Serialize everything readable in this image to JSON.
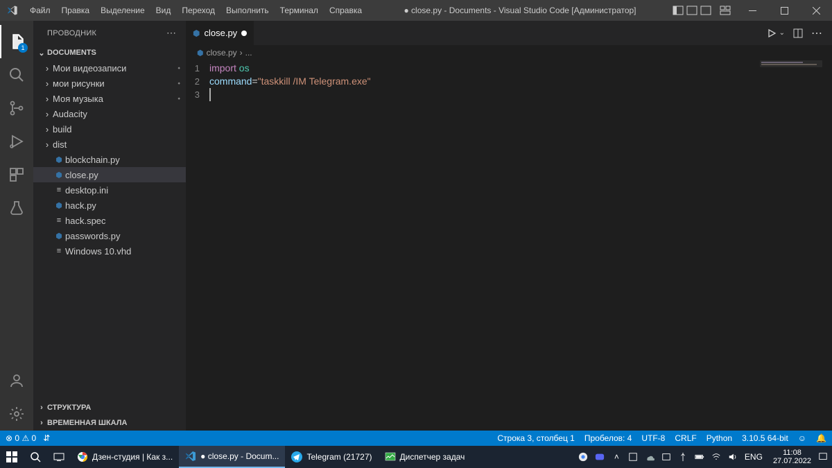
{
  "titlebar": {
    "menus": [
      "Файл",
      "Правка",
      "Выделение",
      "Вид",
      "Переход",
      "Выполнить",
      "Терминал",
      "Справка"
    ],
    "title": "● close.py - Documents - Visual Studio Code [Администратор]"
  },
  "activity": {
    "explorer_badge": "1"
  },
  "sidebar": {
    "header": "ПРОВОДНИК",
    "root": "DOCUMENTS",
    "items": [
      {
        "type": "folder",
        "label": "Мои видеозаписи",
        "git": "⬩"
      },
      {
        "type": "folder",
        "label": "мои рисунки",
        "git": "⬩"
      },
      {
        "type": "folder",
        "label": "Моя музыка",
        "git": "⬩"
      },
      {
        "type": "folder",
        "label": "Audacity"
      },
      {
        "type": "folder",
        "label": "build"
      },
      {
        "type": "folder",
        "label": "dist"
      },
      {
        "type": "file",
        "icon": "py",
        "label": "blockchain.py"
      },
      {
        "type": "file",
        "icon": "py",
        "label": "close.py",
        "selected": true
      },
      {
        "type": "file",
        "icon": "txt",
        "label": "desktop.ini"
      },
      {
        "type": "file",
        "icon": "py",
        "label": "hack.py"
      },
      {
        "type": "file",
        "icon": "txt",
        "label": "hack.spec"
      },
      {
        "type": "file",
        "icon": "py",
        "label": "passwords.py"
      },
      {
        "type": "file",
        "icon": "txt",
        "label": "Windows 10.vhd"
      }
    ],
    "sect_struct": "СТРУКТУРА",
    "sect_timeline": "ВРЕМЕННАЯ ШКАЛА"
  },
  "tab": {
    "label": "close.py"
  },
  "breadcrumb": {
    "file": "close.py",
    "tail": "..."
  },
  "code": {
    "lines": [
      {
        "n": "1",
        "kind": "import",
        "kw": "import",
        "mod": "os"
      },
      {
        "n": "2",
        "kind": "assign",
        "var": "command",
        "op": "=",
        "str": "\"taskkill /IM Telegram.exe\""
      },
      {
        "n": "3",
        "kind": "blank"
      }
    ]
  },
  "status": {
    "left": {
      "errors": "0",
      "warnings": "0",
      "ports_icon": "⇵"
    },
    "right": {
      "pos": "Строка 3, столбец 1",
      "spaces": "Пробелов: 4",
      "enc": "UTF-8",
      "eol": "CRLF",
      "lang": "Python",
      "py": "3.10.5 64-bit"
    }
  },
  "taskbar": {
    "apps": [
      {
        "icon": "chrome",
        "label": "Дзен-студия | Как з..."
      },
      {
        "icon": "vscode",
        "label": "● close.py - Docum...",
        "active": true
      },
      {
        "icon": "telegram",
        "label": "Telegram (21727)"
      },
      {
        "icon": "taskmgr",
        "label": "Диспетчер задач"
      }
    ],
    "lang": "ENG",
    "time": "11:08",
    "date": "27.07.2022"
  }
}
